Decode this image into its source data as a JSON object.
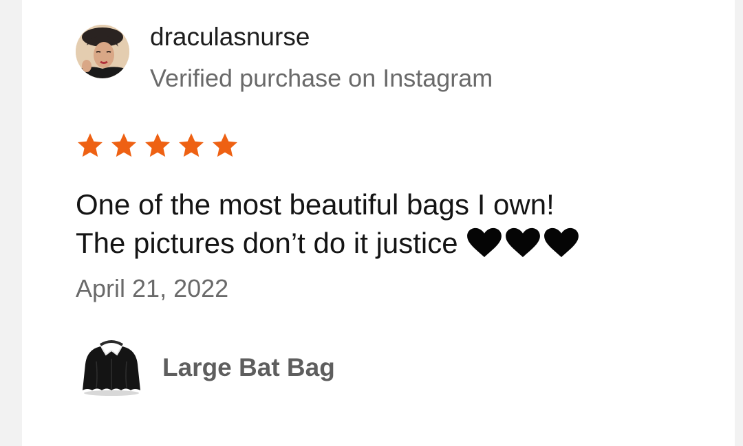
{
  "review": {
    "author": {
      "username": "draculasnurse",
      "verification": "Verified purchase on Instagram",
      "avatar_icon": "user-avatar-photo"
    },
    "rating": {
      "value": 5,
      "max": 5,
      "star_color": "#ee6113"
    },
    "text_lines": [
      "One of the most beautiful bags I own!",
      "The pictures don’t do it justice"
    ],
    "emoji": [
      "black-heart",
      "black-heart",
      "black-heart"
    ],
    "date": "April 21, 2022",
    "product": {
      "name": "Large Bat Bag",
      "thumbnail_icon": "bat-bag-icon"
    }
  }
}
